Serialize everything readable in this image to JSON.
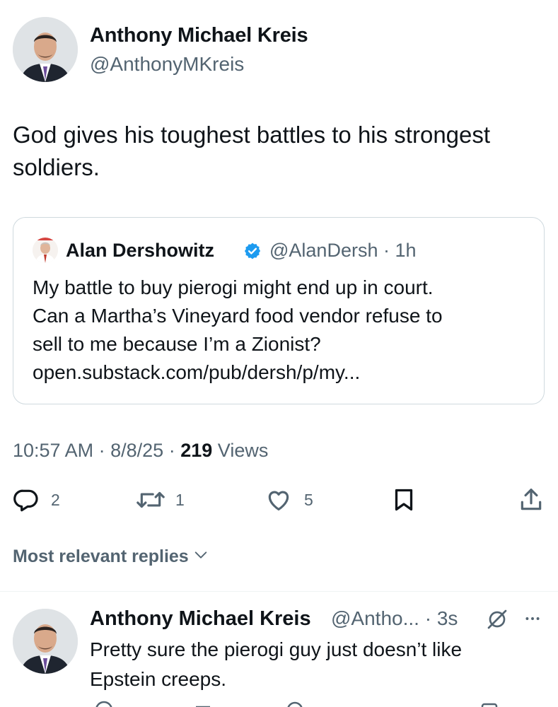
{
  "tweet": {
    "author_name": "Anthony Michael Kreis",
    "author_handle": "@AnthonyMKreis",
    "text": "God gives his toughest battles to his strongest soldiers.",
    "time": "10:57 AM",
    "sep1": "·",
    "date": "8/8/25",
    "sep2": "·",
    "views_count": "219",
    "views_label": "Views"
  },
  "quote": {
    "author_name": "Alan Dershowitz",
    "verified_icon": "verified-badge-icon",
    "handle_time": "@AlanDersh · 1h",
    "text_lines": [
      "My battle to buy pierogi might end up in court.",
      "Can a Martha’s Vineyard food vendor refuse to",
      "sell to me because I’m a Zionist?",
      "open.substack.com/pub/dersh/p/my..."
    ]
  },
  "actions": {
    "reply_count": "2",
    "retweet_count": "1",
    "like_count": "5"
  },
  "replies_sort": {
    "label": "Most relevant replies",
    "icon": "chevron-down-icon"
  },
  "reply": {
    "author_name": "Anthony Michael Kreis",
    "handle_time": "@Antho... · 3s",
    "text_lines": [
      "Pretty sure the pierogi guy just doesn’t like",
      "Epstein creeps."
    ]
  },
  "colors": {
    "secondary_text": "#536471",
    "primary_text": "#0f1419",
    "verified_blue": "#1d9bf0",
    "border": "#cfd9de"
  }
}
